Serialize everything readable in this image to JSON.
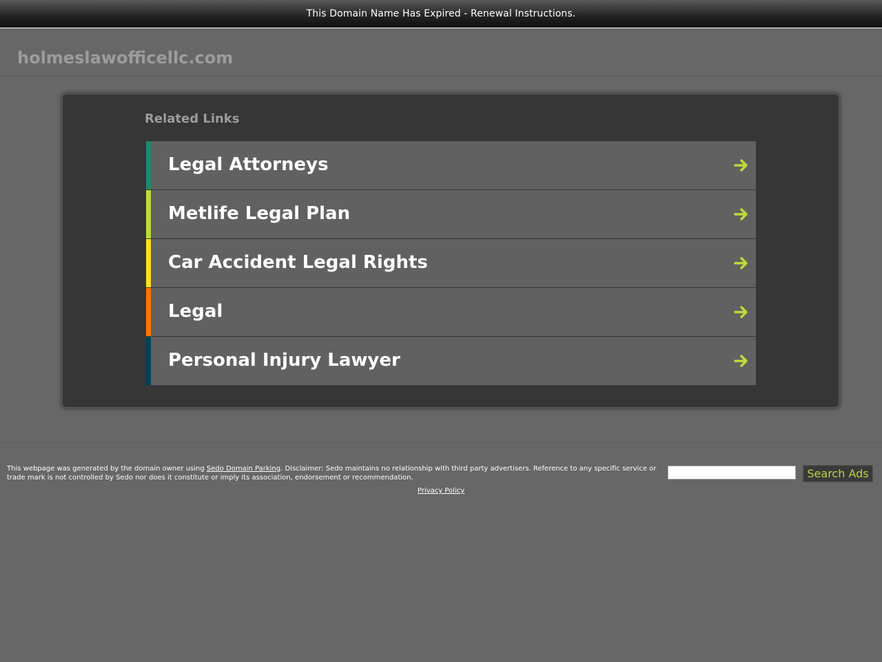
{
  "top_banner": {
    "text": "This Domain Name Has Expired - Renewal Instructions."
  },
  "header": {
    "domain": "holmeslawofficellc.com"
  },
  "related": {
    "title": "Related Links",
    "items": [
      {
        "label": "Legal Attorneys",
        "stripe_color": "#1f8a70",
        "arrow_icon": "arrow-right-icon"
      },
      {
        "label": "Metlife Legal Plan",
        "stripe_color": "#bedb39",
        "arrow_icon": "arrow-right-icon"
      },
      {
        "label": "Car Accident Legal Rights",
        "stripe_color": "#ffe11a",
        "arrow_icon": "arrow-right-icon"
      },
      {
        "label": "Legal",
        "stripe_color": "#fd7400",
        "arrow_icon": "arrow-right-icon"
      },
      {
        "label": "Personal Injury Lawyer",
        "stripe_color": "#004358",
        "arrow_icon": "arrow-right-icon"
      }
    ],
    "arrow_color": "#bedb39"
  },
  "footer": {
    "disclaimer_prefix": "This webpage was generated by the domain owner using ",
    "sedo_link": "Sedo Domain Parking",
    "disclaimer_suffix": ". Disclaimer: Sedo maintains no relationship with third party advertisers. Reference to any specific service or trade mark is not controlled by Sedo nor does it constitute or imply its association, endorsement or recommendation.",
    "privacy_link": "Privacy Policy",
    "search_value": "",
    "search_button": "Search Ads"
  },
  "colors": {
    "background": "#676767",
    "panel": "#363636",
    "link_bg": "#616161",
    "accent": "#bedb39"
  }
}
